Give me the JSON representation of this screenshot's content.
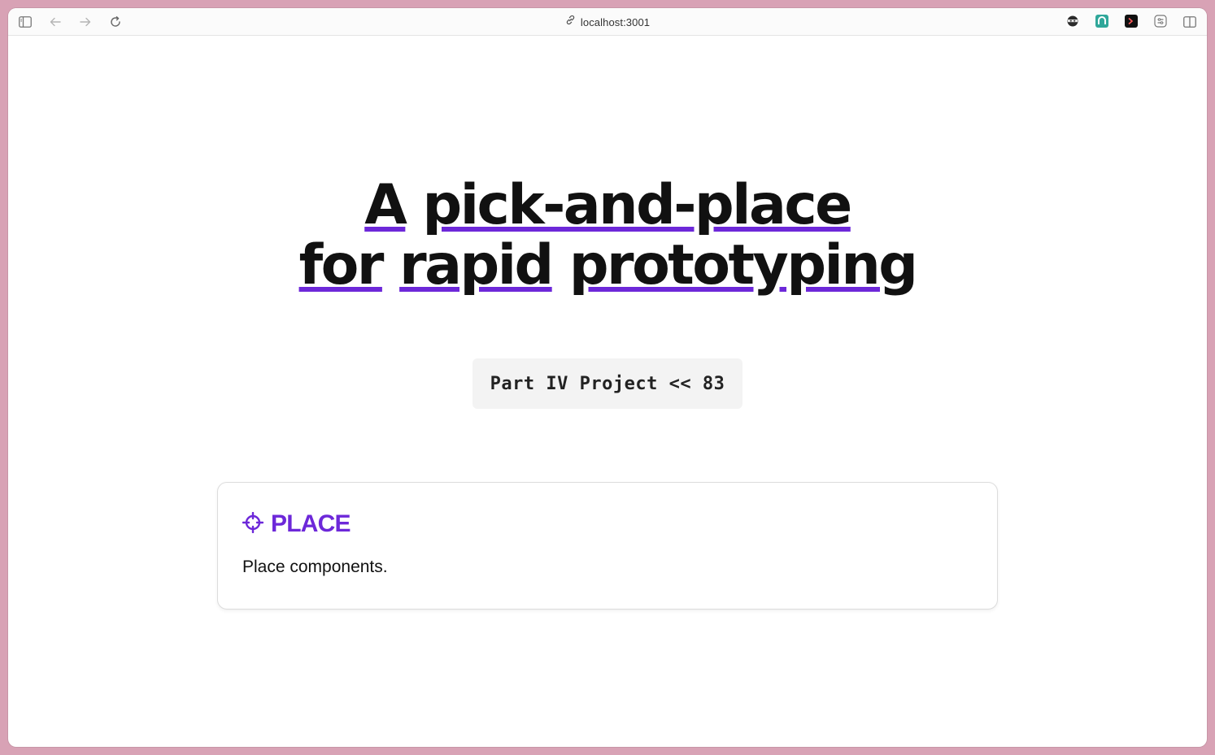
{
  "browser": {
    "url": "localhost:3001",
    "back_icon": "arrow-left-icon",
    "forward_icon": "arrow-right-icon",
    "reload_icon": "reload-icon",
    "sidebar_icon": "sidebar-icon",
    "split_icon": "split-view-icon"
  },
  "hero": {
    "line1_word1": "A",
    "line1_word2": "pick-and-place",
    "line2_word1": "for",
    "line2_word2": "rapid",
    "line2_word3": "prototyping",
    "underline_color": "#6d28d9"
  },
  "badge": {
    "text": "Part IV Project << 83"
  },
  "card": {
    "icon": "crosshair-icon",
    "title": "PLACE",
    "description": "Place components.",
    "accent": "#6d28d9"
  }
}
